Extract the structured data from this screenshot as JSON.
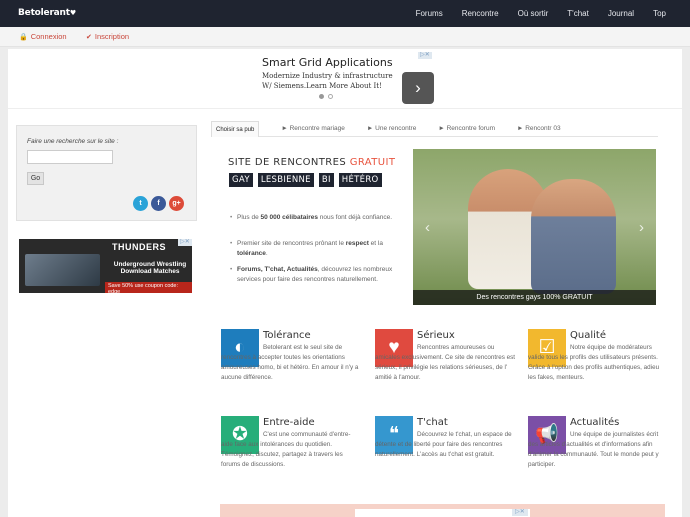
{
  "header": {
    "logo": "Betolerant",
    "nav": [
      "Forums",
      "Rencontre",
      "Où sortir",
      "T'chat",
      "Journal",
      "Top"
    ]
  },
  "auth": {
    "login": "Connexion",
    "signup": "Inscription"
  },
  "top_ad": {
    "title": "Smart Grid Applications",
    "line1": "Modernize Industry & infrastructure",
    "line2": "W/ Siemens.Learn More About It!",
    "close": "▷✕"
  },
  "search": {
    "label": "Faire une recherche sur le site :",
    "input_value": "",
    "button": "Go",
    "social": [
      "t",
      "f",
      "g+"
    ]
  },
  "side_ad": {
    "brand": "THUNDERS",
    "line1": "Underground Wrestling",
    "line2": "Download Matches",
    "promo": "Save 50% use coupon code: edge"
  },
  "tabs": {
    "first": "Choisir sa pub",
    "links": [
      "► Rencontre mariage",
      "► Une rencontre",
      "► Rencontre forum",
      "► Rencontr 03"
    ]
  },
  "hero": {
    "title_prefix": "SITE DE RENCONTRES ",
    "title_accent": "GRATUIT",
    "tags": [
      "GAY",
      "LESBIENNE",
      "BI",
      "HÉTÉRO"
    ],
    "b1_pre": "Plus de ",
    "b1_bold": "50 000 célibataires",
    "b1_post": " nous font déjà confiance.",
    "b2_pre": "Premier site de rencontres prônant le ",
    "b2_bold1": "respect",
    "b2_mid": " et la ",
    "b2_bold2": "tolérance",
    "b2_post": ".",
    "b3_bold": "Forums, T'chat, Actualités",
    "b3_post": ", découvrez les nombreux services pour faire des rencontres naturellement.",
    "photo_caption": "Des rencontres gays 100% GRATUIT"
  },
  "features": [
    {
      "title": "Tolérance",
      "text": "Betolerant est le seul site de rencontres à accepter toutes les orientations amoureuses homo, bi et hétéro. En amour il n'y a aucune différence.",
      "color": "#1e7dbd",
      "icon": "◐"
    },
    {
      "title": "Sérieux",
      "text": "Rencontres amoureuses ou amicales exclusivement. Ce site de rencontres est sérieux, il privilégie les relations sérieuses, de l' amitié à l'amour.",
      "color": "#e04a3f",
      "icon": "♥"
    },
    {
      "title": "Qualité",
      "text": "Notre équipe de modérateurs valide tous les profils des utilisateurs présents. Grâce à l'option des profils authentiques, adieu les fakes, menteurs.",
      "color": "#f2b82e",
      "icon": "☑"
    },
    {
      "title": "Entre-aide",
      "text": "C'est une communauté d'entre-aide face aux intolérances du quotidien. Témoignez, discutez, partagez à travers les forums de discussions.",
      "color": "#27ae7a",
      "icon": "✪"
    },
    {
      "title": "T'chat",
      "text": "Découvrez le t'chat, un espace de détente et de liberté pour faire des rencontres naturellement. L'accès au t'chat est gratuit.",
      "color": "#3597cf",
      "icon": "❝"
    },
    {
      "title": "Actualités",
      "text": "Une équipe de journalistes écrit des articles d'actualités et d'informations afin d'animer la communauté. Tout le monde peut y participer.",
      "color": "#7b4fa6",
      "icon": "📢"
    }
  ]
}
